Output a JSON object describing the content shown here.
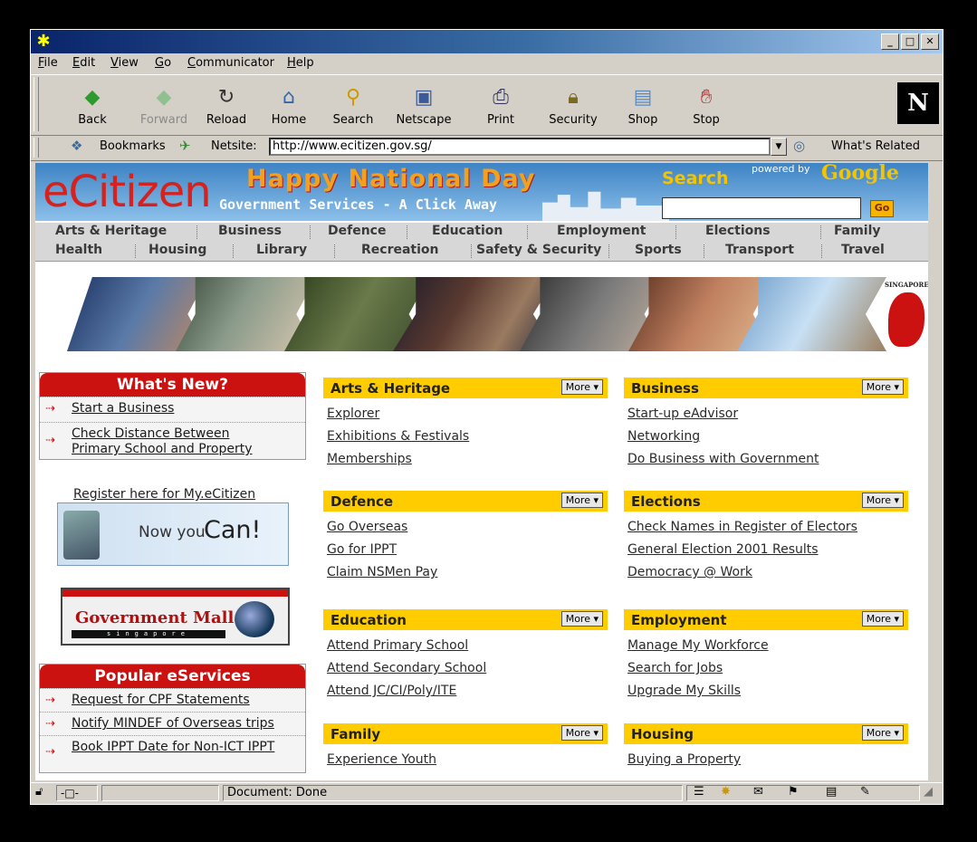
{
  "menu": [
    "File",
    "Edit",
    "View",
    "Go",
    "Communicator",
    "Help"
  ],
  "toolbar": [
    {
      "label": "Back",
      "icon": "back-icon",
      "glyph": "◆",
      "color": "#2c9a2c",
      "disabled": false
    },
    {
      "label": "Forward",
      "icon": "forward-icon",
      "glyph": "◆",
      "color": "#90c090",
      "disabled": true
    },
    {
      "label": "Reload",
      "icon": "reload-icon",
      "glyph": "↻",
      "color": "#333",
      "disabled": false
    },
    {
      "label": "Home",
      "icon": "home-icon",
      "glyph": "⌂",
      "color": "#3366aa",
      "disabled": false
    },
    {
      "label": "Search",
      "icon": "search-icon",
      "glyph": "⚲",
      "color": "#cc9a00",
      "disabled": false
    },
    {
      "label": "Netscape",
      "icon": "netscape-icon",
      "glyph": "▣",
      "color": "#3a5a9a",
      "disabled": false
    },
    {
      "label": "Print",
      "icon": "print-icon",
      "glyph": "⎙",
      "color": "#335",
      "disabled": false
    },
    {
      "label": "Security",
      "icon": "security-lock-icon",
      "glyph": "🔒︎",
      "color": "#7a6a20",
      "disabled": false
    },
    {
      "label": "Shop",
      "icon": "shop-icon",
      "glyph": "▤",
      "color": "#5a8ac0",
      "disabled": false
    },
    {
      "label": "Stop",
      "icon": "stop-icon",
      "glyph": "✋︎",
      "color": "#aa2020",
      "disabled": false
    }
  ],
  "location": {
    "bookmarks": "Bookmarks",
    "netsite_label": "Netsite:",
    "url": "http://www.ecitizen.gov.sg/",
    "whats_related": "What's Related"
  },
  "banner": {
    "logo": "eCitizen",
    "greeting": "Happy National Day",
    "tagline": "Government Services - A Click Away",
    "search": "Search",
    "powered_by": "powered by",
    "google": "Google",
    "go": "Go"
  },
  "nav_row1": [
    "Arts & Heritage",
    "Business",
    "Defence",
    "Education",
    "Employment",
    "Elections",
    "Family"
  ],
  "nav_row2": [
    "Health",
    "Housing",
    "Library",
    "Recreation",
    "Safety & Security",
    "Sports",
    "Transport",
    "Travel"
  ],
  "brand_label": "SINGAPORE",
  "whats_new": {
    "title": "What's New?",
    "items": [
      "Start a Business",
      "Check Distance Between Primary School and Property"
    ]
  },
  "register": {
    "label": "Register here for My.eCitizen",
    "promo_prefix": "Now you",
    "promo_big": "Can!"
  },
  "gov_mall": {
    "title": "Government Mall",
    "subtitle": "singapore"
  },
  "popular": {
    "title": "Popular eServices",
    "items": [
      "Request for CPF Statements",
      "Notify MINDEF of Overseas trips",
      "Book IPPT Date for Non-ICT IPPT"
    ]
  },
  "more_label": "More ▾",
  "sections": [
    {
      "title": "Arts & Heritage",
      "links": [
        "Explorer",
        "Exhibitions & Festivals",
        "Memberships"
      ]
    },
    {
      "title": "Business",
      "links": [
        "Start-up eAdvisor",
        "Networking",
        "Do Business with Government"
      ]
    },
    {
      "title": "Defence",
      "links": [
        "Go Overseas",
        "Go for IPPT",
        "Claim NSMen Pay"
      ]
    },
    {
      "title": "Elections",
      "links": [
        "Check Names in Register of Electors",
        "General Election 2001 Results",
        "Democracy @ Work"
      ]
    },
    {
      "title": "Education",
      "links": [
        "Attend Primary School",
        "Attend Secondary School",
        "Attend JC/CI/Poly/ITE"
      ]
    },
    {
      "title": "Employment",
      "links": [
        "Manage My Workforce",
        "Search for Jobs",
        "Upgrade My Skills"
      ]
    },
    {
      "title": "Family",
      "links": [
        "Experience Youth"
      ]
    },
    {
      "title": "Housing",
      "links": [
        "Buying a Property"
      ]
    }
  ],
  "status": {
    "text": "Document: Done"
  }
}
